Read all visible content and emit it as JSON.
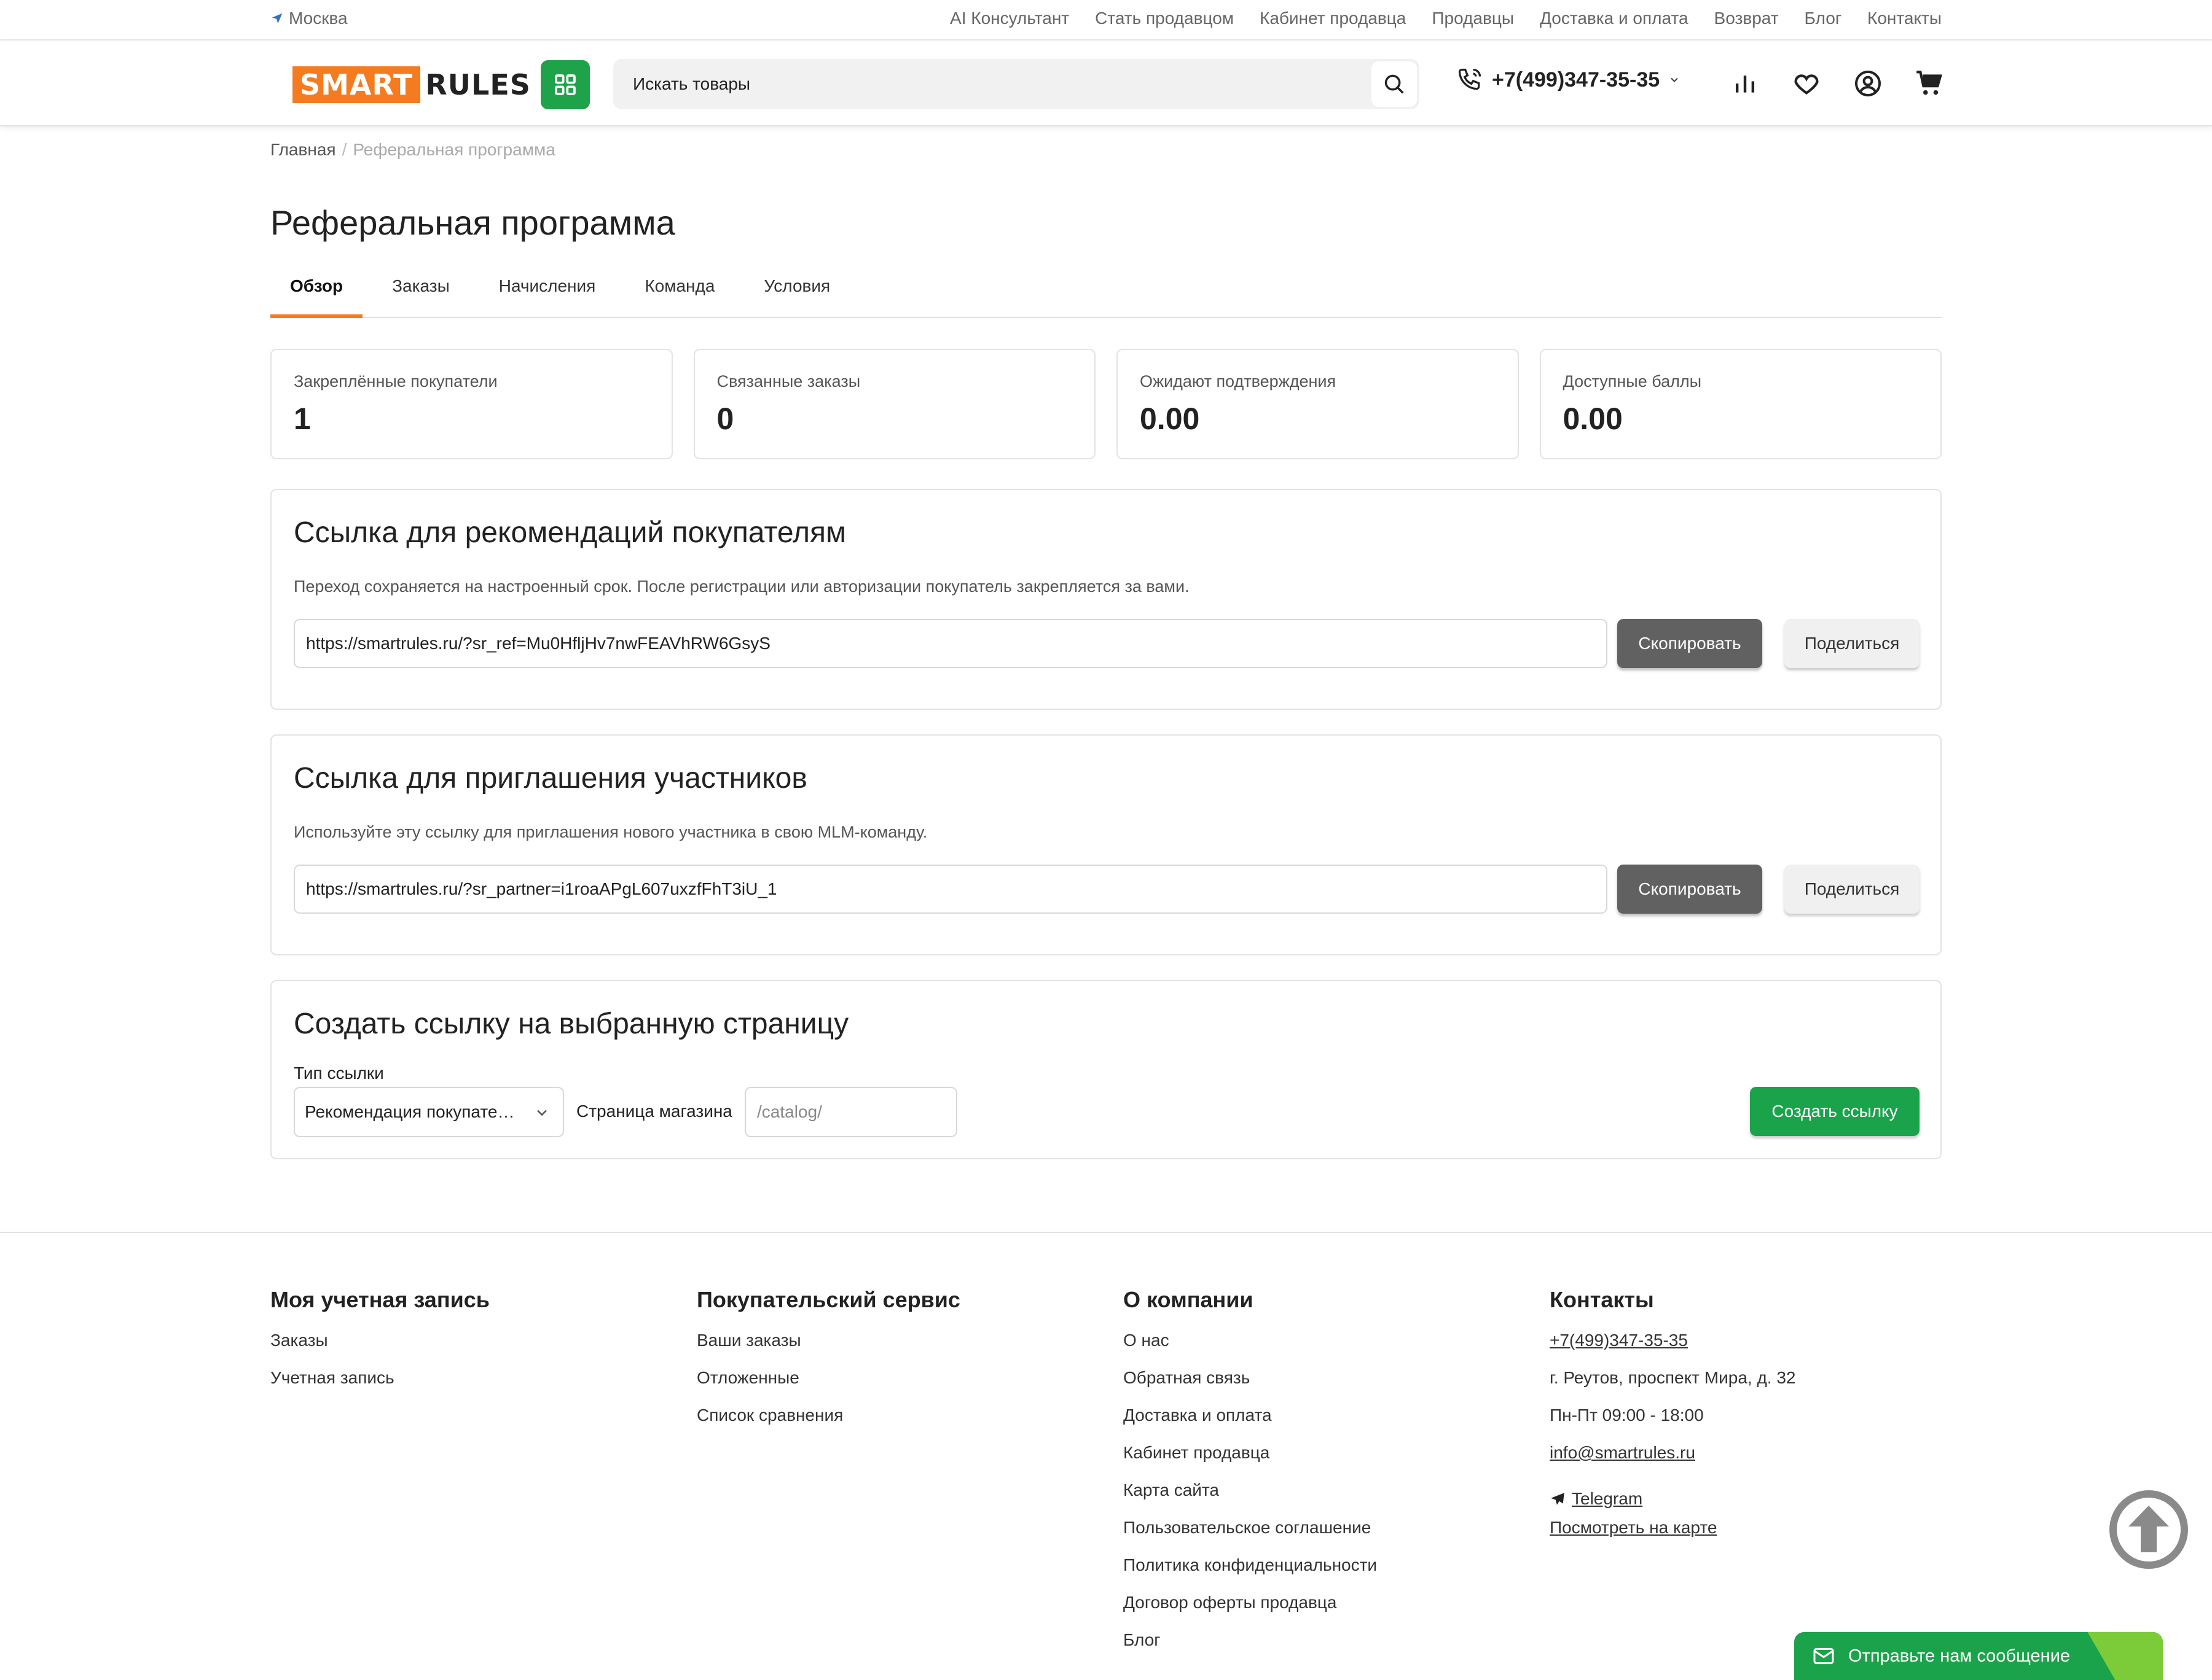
{
  "topbar": {
    "city": "Москва",
    "links": [
      "AI Консультант",
      "Стать продавцом",
      "Кабинет продавца",
      "Продавцы",
      "Доставка и оплата",
      "Возврат",
      "Блог",
      "Контакты"
    ]
  },
  "header": {
    "logo_left": "SMART",
    "logo_right": "RULES",
    "search_placeholder": "Искать товары",
    "phone": "+7(499)347-35-35"
  },
  "breadcrumb": {
    "home": "Главная",
    "separator": "/",
    "current": "Реферальная программа"
  },
  "page_title": "Реферальная программа",
  "tabs": [
    {
      "label": "Обзор",
      "active": true
    },
    {
      "label": "Заказы",
      "active": false
    },
    {
      "label": "Начисления",
      "active": false
    },
    {
      "label": "Команда",
      "active": false
    },
    {
      "label": "Условия",
      "active": false
    }
  ],
  "stats": [
    {
      "label": "Закреплённые покупатели",
      "value": "1"
    },
    {
      "label": "Связанные заказы",
      "value": "0"
    },
    {
      "label": "Ожидают подтверждения",
      "value": "0.00"
    },
    {
      "label": "Доступные баллы",
      "value": "0.00"
    }
  ],
  "customer_link": {
    "title": "Ссылка для рекомендаций покупателям",
    "description": "Переход сохраняется на настроенный срок. После регистрации или авторизации покупатель закрепляется за вами.",
    "url": "https://smartrules.ru/?sr_ref=Mu0HfljHv7nwFEAVhRW6GsyS",
    "copy_label": "Скопировать",
    "share_label": "Поделиться"
  },
  "partner_link": {
    "title": "Ссылка для приглашения участников",
    "description": "Используйте эту ссылку для приглашения нового участника в свою MLM-команду.",
    "url": "https://smartrules.ru/?sr_partner=i1roaAPgL607uxzfFhT3iU_1",
    "copy_label": "Скопировать",
    "share_label": "Поделиться"
  },
  "create_link": {
    "title": "Создать ссылку на выбранную страницу",
    "type_label": "Тип ссылки",
    "type_value": "Рекомендация покупате…",
    "page_label": "Страница магазина",
    "page_placeholder": "/catalog/",
    "button_label": "Создать ссылку"
  },
  "footer": {
    "account": {
      "title": "Моя учетная запись",
      "items": [
        "Заказы",
        "Учетная запись"
      ]
    },
    "service": {
      "title": "Покупательский сервис",
      "items": [
        "Ваши заказы",
        "Отложенные",
        "Список сравнения"
      ]
    },
    "company": {
      "title": "О компании",
      "items": [
        "О нас",
        "Обратная связь",
        "Доставка и оплата",
        "Кабинет продавца",
        "Карта сайта",
        "Пользовательское соглашение",
        "Политика конфиденциальности",
        "Договор оферты продавца",
        "Блог"
      ]
    },
    "contacts": {
      "title": "Контакты",
      "phone": "+7(499)347-35-35",
      "address": "г. Реутов, проспект Мира, д. 32",
      "hours": "Пн-Пт 09:00 - 18:00",
      "email": "info@smartrules.ru",
      "telegram": "Telegram",
      "map": "Посмотреть на карте"
    }
  },
  "chat": {
    "label": "Отправьте нам сообщение"
  },
  "colors": {
    "accent_orange": "#f47b20",
    "brand_green": "#1aa34a",
    "dark_button": "#616161"
  }
}
